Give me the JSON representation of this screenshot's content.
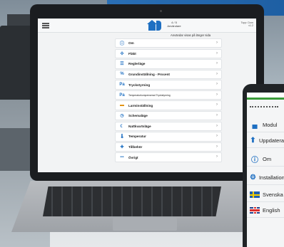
{
  "laptop_app": {
    "device_info_line1": "4 / 5",
    "device_info_line2": "Användare",
    "right_info_line1": "Topp: Dom",
    "right_info_line2": "v1.2",
    "tip": "Användar visas på länger sida",
    "menu": [
      {
        "label": "Om",
        "icon": "info-icon",
        "glyph": "ⓘ"
      },
      {
        "label": "Fläkt",
        "icon": "fan-icon",
        "glyph": "✣"
      },
      {
        "label": "Reglerläge",
        "icon": "list-icon",
        "glyph": "☰"
      },
      {
        "label": "Grundinställning - Procent",
        "icon": "percent-icon",
        "glyph": "%"
      },
      {
        "label": "Tryckstyrning",
        "icon": "pressure-icon",
        "glyph": "Pa"
      },
      {
        "label": "Temperaturkompenserad Tryckstyrning",
        "icon": "temp-pressure-icon",
        "glyph": "Pa"
      },
      {
        "label": "Larminställning",
        "icon": "alarm-icon",
        "glyph": "▬"
      },
      {
        "label": "Schemaläge",
        "icon": "schedule-icon",
        "glyph": "◷"
      },
      {
        "label": "Nattkvartsläge",
        "icon": "night-icon",
        "glyph": "☾"
      },
      {
        "label": "Temperatur",
        "icon": "thermometer-icon",
        "glyph": "🌡"
      },
      {
        "label": "Tillbehör",
        "icon": "accessory-icon",
        "glyph": "✚"
      },
      {
        "label": "Övrigt",
        "icon": "more-icon",
        "glyph": "•••"
      }
    ],
    "chevron": "›"
  },
  "tablet_app": {
    "items": [
      {
        "label": "Modul",
        "icon": "module-icon"
      },
      {
        "label": "Uppdatera",
        "icon": "update-icon"
      },
      {
        "label": "Om",
        "icon": "info-icon"
      },
      {
        "label": "Installation",
        "icon": "installation-icon"
      },
      {
        "label": "Svenska",
        "icon": "swedish-flag-icon"
      },
      {
        "label": "English",
        "icon": "english-flag-icon"
      }
    ]
  },
  "colors": {
    "accent": "#1e6fc2",
    "status_green": "#3a9b3a"
  }
}
